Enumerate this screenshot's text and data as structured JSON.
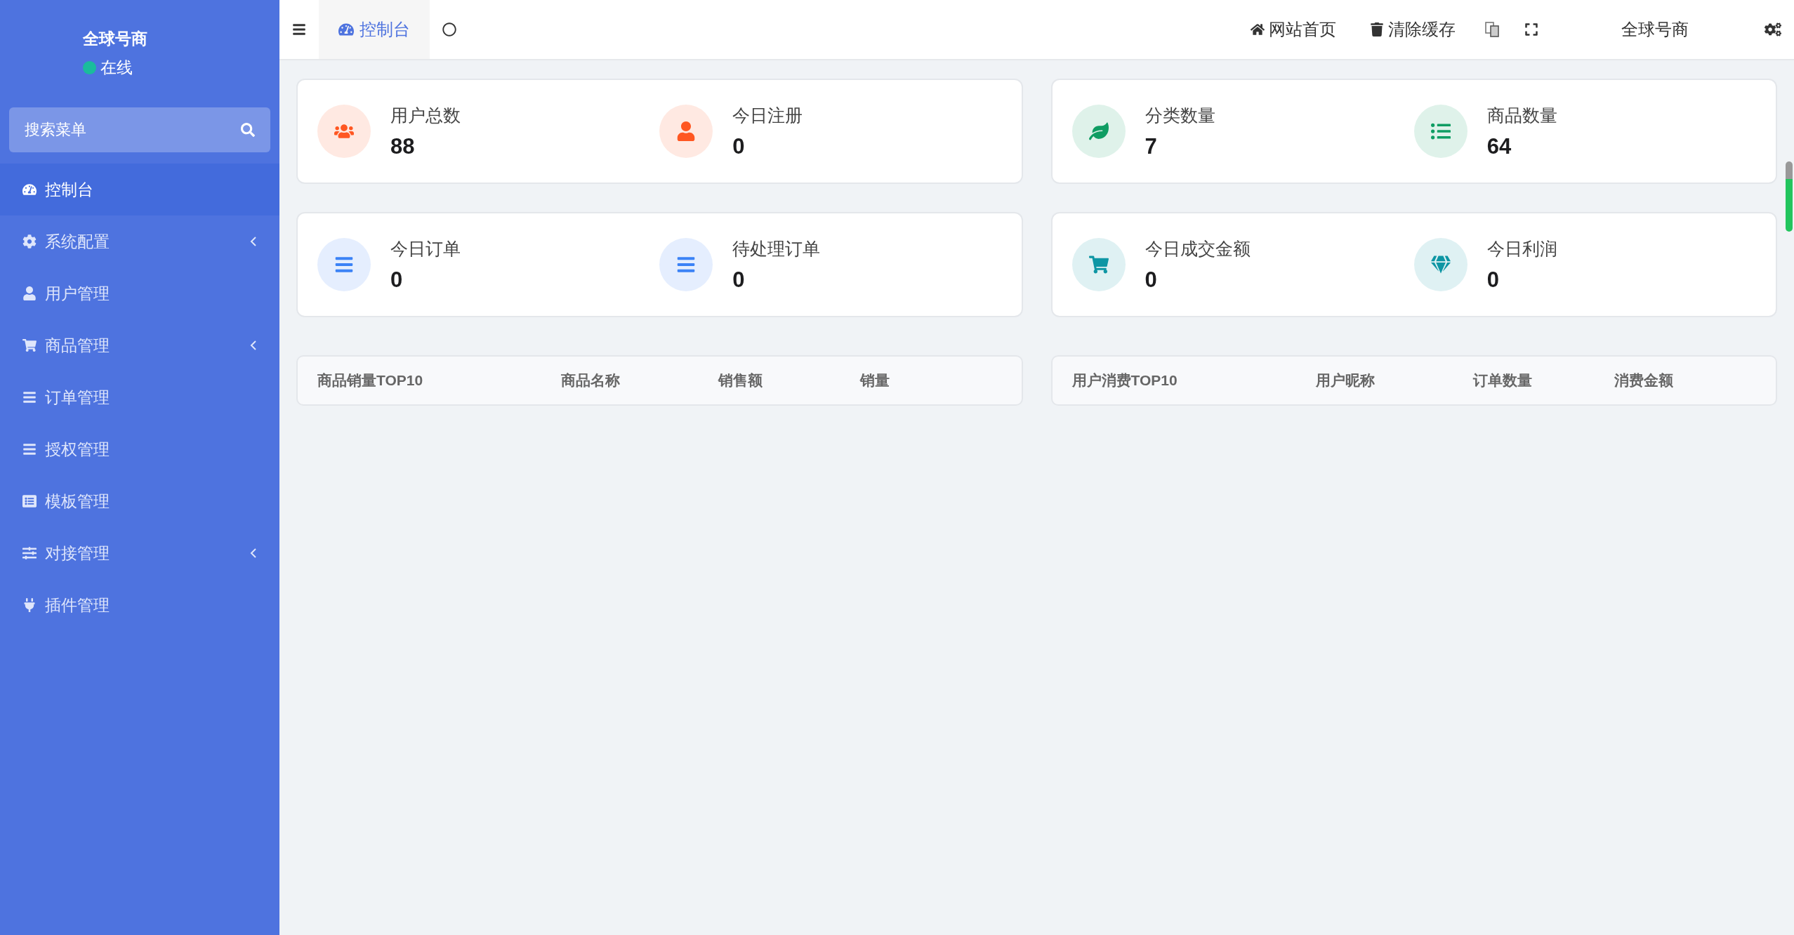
{
  "sidebar": {
    "brand": "全球号商",
    "status": {
      "label": "在线",
      "color": "#1abc9c"
    },
    "search": {
      "placeholder": "搜索菜单"
    },
    "items": [
      {
        "label": "控制台",
        "kind": "gauge",
        "selected": true,
        "submenu": false
      },
      {
        "label": "系统配置",
        "kind": "gear",
        "selected": false,
        "submenu": true
      },
      {
        "label": "用户管理",
        "kind": "user",
        "selected": false,
        "submenu": false
      },
      {
        "label": "商品管理",
        "kind": "cart",
        "selected": false,
        "submenu": true
      },
      {
        "label": "订单管理",
        "kind": "bars",
        "selected": false,
        "submenu": false
      },
      {
        "label": "授权管理",
        "kind": "bars",
        "selected": false,
        "submenu": false
      },
      {
        "label": "模板管理",
        "kind": "listbox",
        "selected": false,
        "submenu": false
      },
      {
        "label": "对接管理",
        "kind": "sliders",
        "selected": false,
        "submenu": true
      },
      {
        "label": "插件管理",
        "kind": "plug",
        "selected": false,
        "submenu": false
      }
    ]
  },
  "topbar": {
    "tabs": [
      {
        "label": "控制台",
        "selected": true
      }
    ],
    "links": [
      {
        "label": "网站首页",
        "kind": "home"
      },
      {
        "label": "清除缓存",
        "kind": "trash"
      }
    ],
    "user": "全球号商"
  },
  "stat_cards": [
    {
      "stats": [
        {
          "label": "用户总数",
          "value": "88",
          "kind": "users",
          "color": "#ff5722"
        },
        {
          "label": "今日注册",
          "value": "0",
          "kind": "user",
          "color": "#ff5722"
        }
      ]
    },
    {
      "stats": [
        {
          "label": "分类数量",
          "value": "7",
          "kind": "leaf",
          "color": "#0f9d63"
        },
        {
          "label": "商品数量",
          "value": "64",
          "kind": "bullets",
          "color": "#0f9d63"
        }
      ]
    },
    {
      "stats": [
        {
          "label": "今日订单",
          "value": "0",
          "kind": "bars",
          "color": "#3b82f6"
        },
        {
          "label": "待处理订单",
          "value": "0",
          "kind": "bars",
          "color": "#3b82f6"
        }
      ]
    },
    {
      "stats": [
        {
          "label": "今日成交金额",
          "value": "0",
          "kind": "cart",
          "color": "#0e96a4"
        },
        {
          "label": "今日利润",
          "value": "0",
          "kind": "gem",
          "color": "#0e96a4"
        }
      ]
    }
  ],
  "tables": [
    {
      "columns": [
        "商品销量TOP10",
        "商品名称",
        "销售额",
        "销量"
      ]
    },
    {
      "columns": [
        "用户消费TOP10",
        "用户昵称",
        "订单数量",
        "消费金额"
      ]
    }
  ]
}
